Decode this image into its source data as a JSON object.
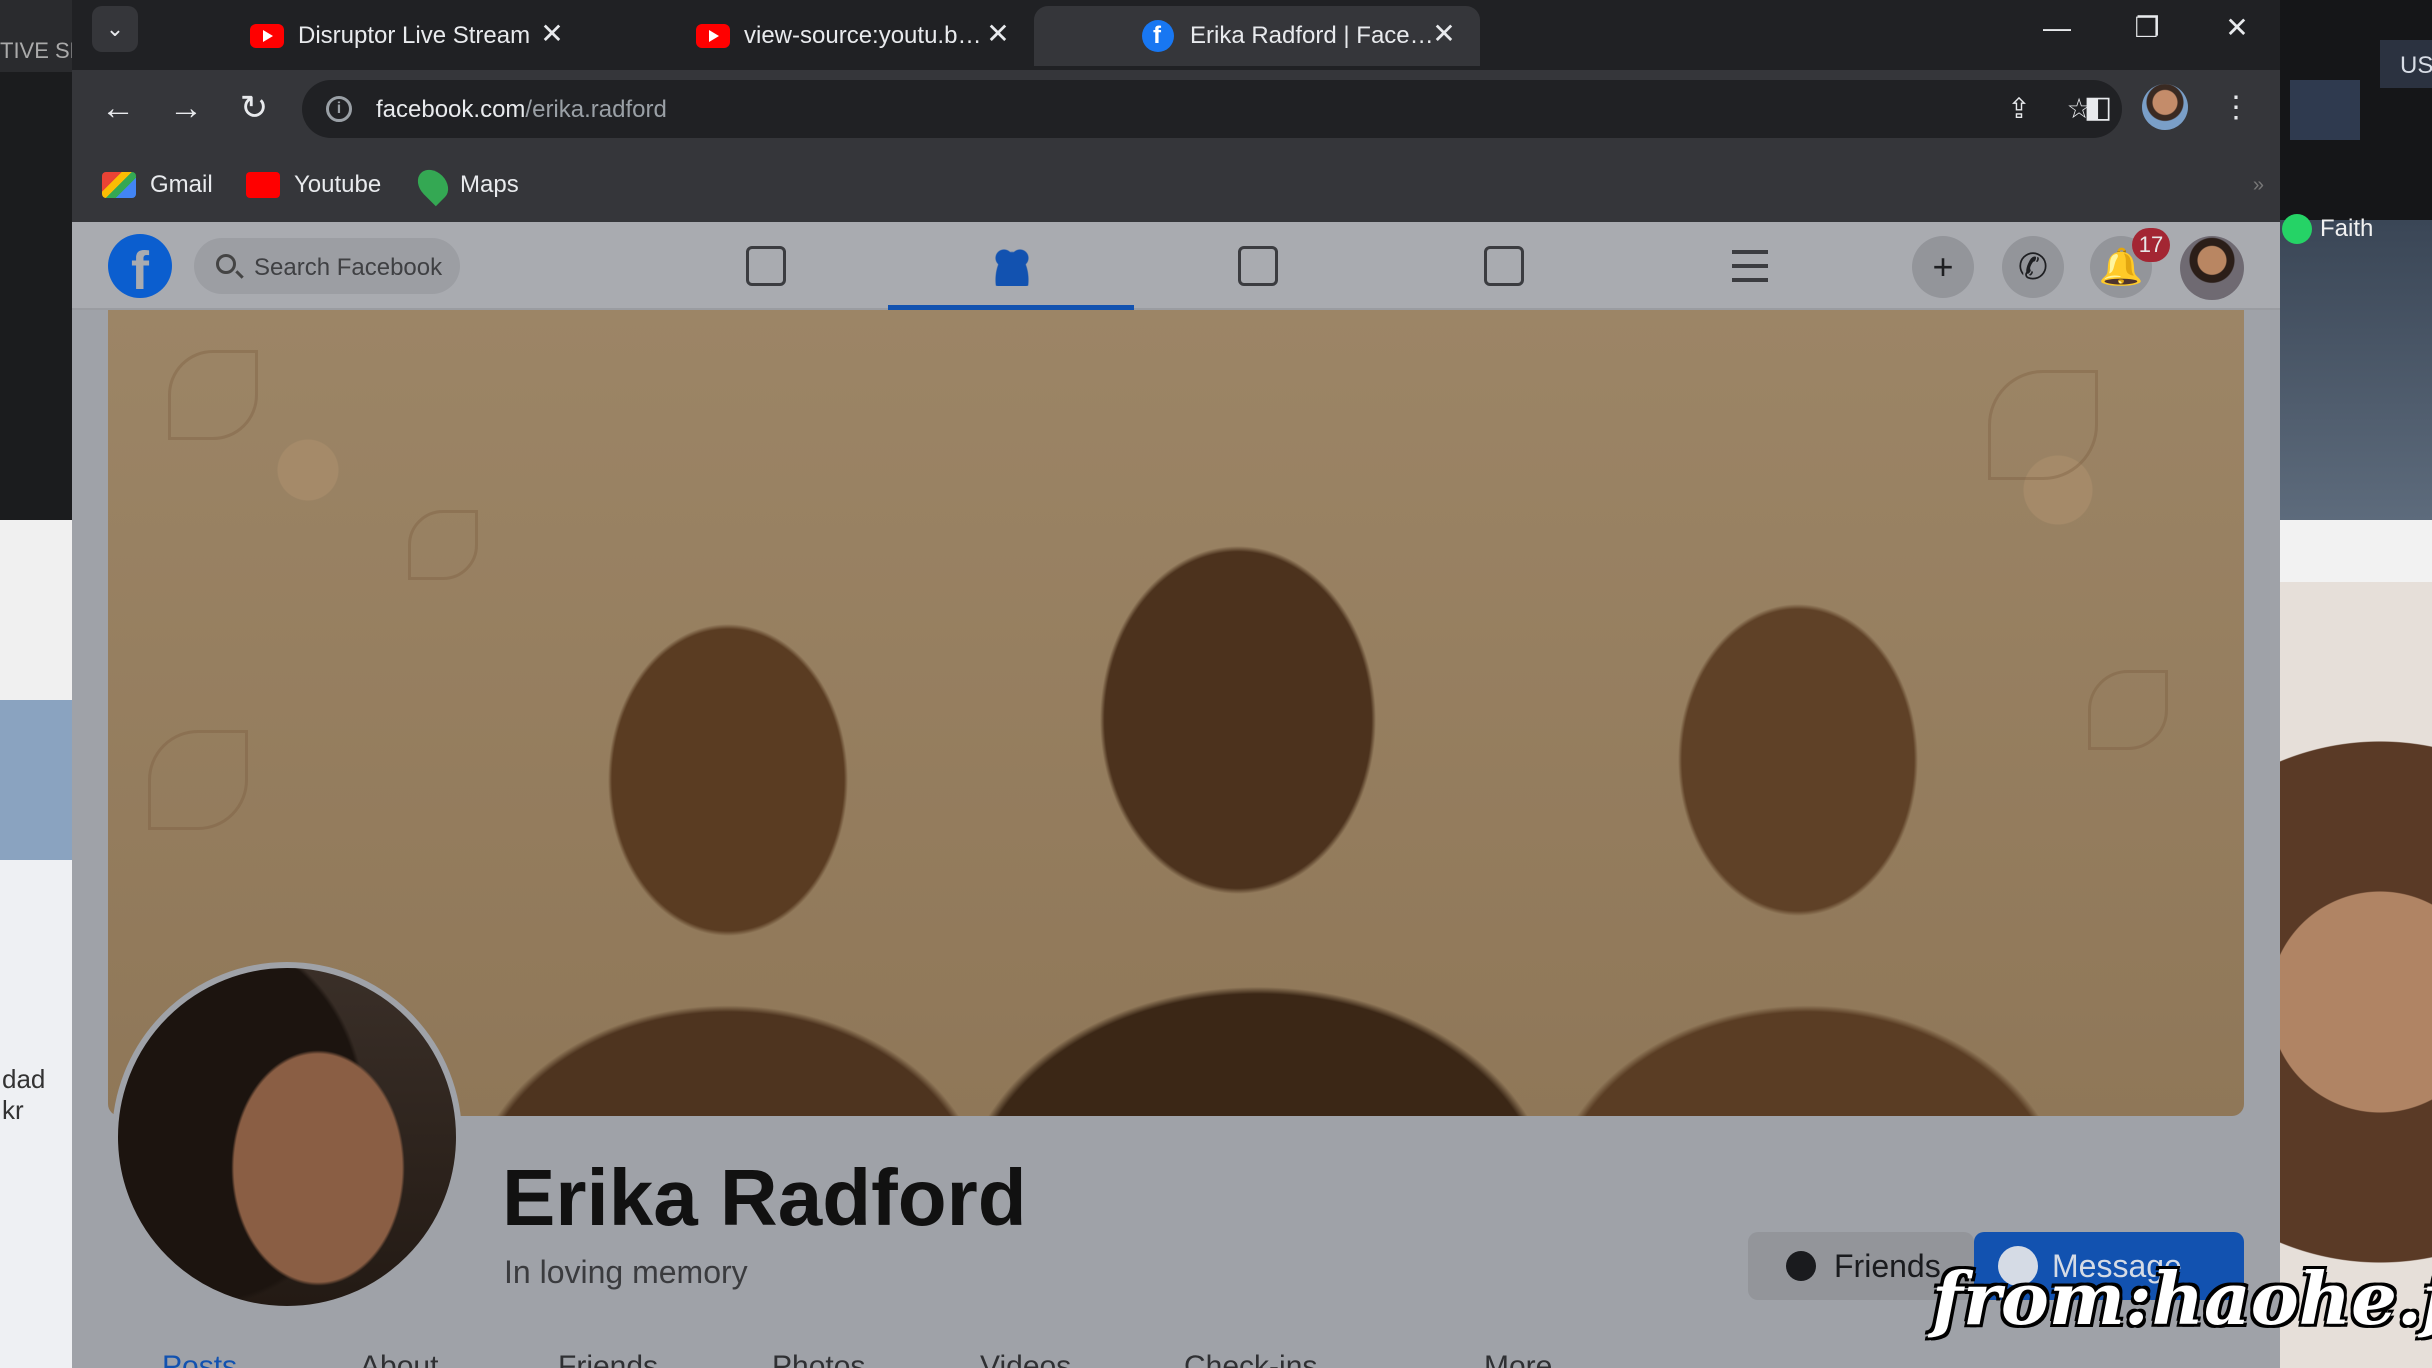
{
  "background": {
    "left_text_top": "TIVE SE",
    "left_text_low": "dad kr",
    "right_tab_text": "US",
    "right_chat_name": "Faith"
  },
  "browser": {
    "tabs": [
      {
        "title": "Disruptor Live Stream",
        "favicon": "youtube-icon",
        "active": false
      },
      {
        "title": "view-source:youtu.be/SasUk...",
        "favicon": "youtube-icon",
        "active": false
      },
      {
        "title": "Erika Radford | Facebook",
        "favicon": "facebook-icon",
        "active": true
      }
    ],
    "url_domain": "facebook.com",
    "url_path": "/erika.radford",
    "bookmarks": [
      {
        "label": "Gmail",
        "icon": "gmail-icon"
      },
      {
        "label": "Youtube",
        "icon": "youtube-icon"
      },
      {
        "label": "Maps",
        "icon": "maps-icon"
      }
    ],
    "bookmarks_more": "»"
  },
  "facebook": {
    "search_placeholder": "Search Facebook",
    "notification_count": "17",
    "profile": {
      "name": "Erika Radford",
      "subtitle": "In loving memory",
      "friends_button": "Friends",
      "message_button": "Message"
    },
    "profile_tabs": [
      "Posts",
      "About",
      "Friends",
      "Photos",
      "Videos",
      "Check-ins",
      "More"
    ],
    "active_profile_tab": "Posts",
    "active_nav": "friends",
    "colors": {
      "accent": "#1877f2",
      "badge": "#e41e3f"
    }
  },
  "watermark": "from:haohe.fun"
}
